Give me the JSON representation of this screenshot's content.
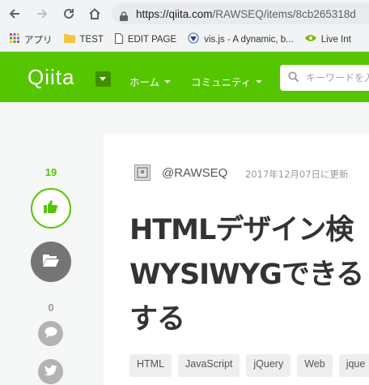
{
  "browser": {
    "url_host": "https://qiita.com",
    "url_path": "/RAWSEQ/items/8cb265318d",
    "bookmarks": [
      {
        "label": "アプリ",
        "icon": "apps-grid-icon"
      },
      {
        "label": "TEST",
        "icon": "folder-icon"
      },
      {
        "label": "EDIT PAGE",
        "icon": "page-icon"
      },
      {
        "label": "vis.js - A dynamic, b...",
        "icon": "visjs-icon"
      },
      {
        "label": "Live Int",
        "icon": "nvidia-icon"
      }
    ]
  },
  "header": {
    "logo": "Qiita",
    "nav": [
      {
        "label": "ホーム"
      },
      {
        "label": "コミュニティ"
      }
    ],
    "search_placeholder": "キーワードを入"
  },
  "actions": {
    "like_count": "19",
    "comment_count": "0"
  },
  "article": {
    "author": "@RAWSEQ",
    "updated": "2017年12月07日に更新",
    "title": "HTMLデザイン検\nWYSIWYGできる\nする",
    "tags": [
      "HTML",
      "JavaScript",
      "jQuery",
      "Web",
      "jque"
    ]
  },
  "colors": {
    "brand": "#55c500"
  }
}
